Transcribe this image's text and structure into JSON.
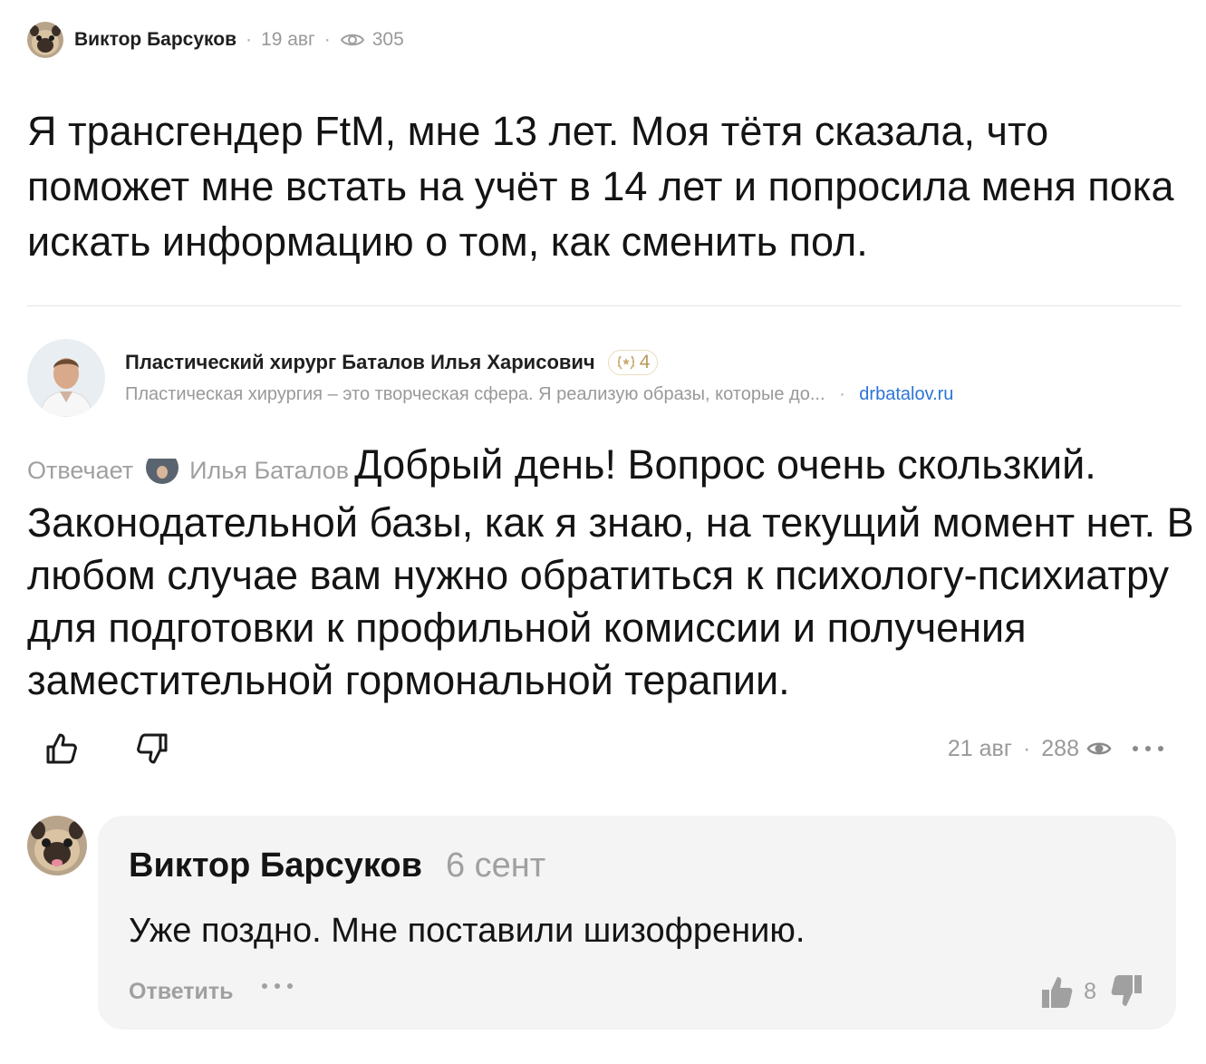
{
  "question": {
    "author": "Виктор Барсуков",
    "date": "19 авг",
    "separator": "·",
    "views": "305",
    "text": "Я трансгендер FtM, мне 13 лет. Моя тётя сказала, что поможет мне встать на учёт в 14 лет и попросила меня пока искать информацию о том, как сменить пол."
  },
  "expert": {
    "name": "Пластический хирург Баталов Илья Харисович",
    "badge_count": "4",
    "description": "Пластическая хирургия – это творческая сфера. Я реализую образы, которые до...",
    "separator": "·",
    "link": "drbatalov.ru"
  },
  "answer": {
    "intro": "Отвечает",
    "responder": "Илья Баталов",
    "text": "Добрый день! Вопрос очень скользкий. Законодательной базы, как я знаю, на текущий момент нет. В любом случае вам нужно обратиться к психологу-психиатру для подготовки к профильной комиссии и получения заместительной гормональной терапии.",
    "date": "21 авг",
    "separator": "·",
    "views": "288"
  },
  "comment": {
    "author": "Виктор Барсуков",
    "date": "6 сент",
    "text": "Уже поздно. Мне поставили шизофрению.",
    "reply_label": "Ответить",
    "likes": "8"
  },
  "icons": {
    "like": "thumbs-up-icon",
    "dislike": "thumbs-down-icon",
    "views": "eye-icon",
    "more": "more-dots-icon",
    "badge": "laurel-icon"
  },
  "colors": {
    "link": "#2b74d8",
    "muted": "#999999",
    "comment_bg": "#f4f4f5",
    "badge": "#b89a5a"
  }
}
